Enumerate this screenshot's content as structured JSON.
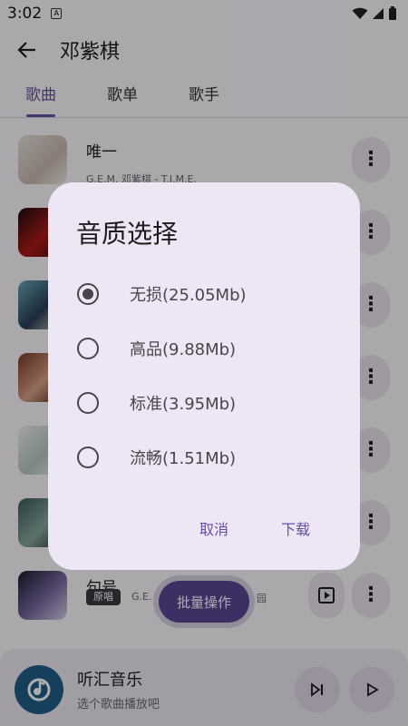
{
  "status": {
    "time": "3:02",
    "notif_glyph": "A"
  },
  "appbar": {
    "title": "邓紫棋"
  },
  "tabs": [
    {
      "label": "歌曲"
    },
    {
      "label": "歌单"
    },
    {
      "label": "歌手"
    }
  ],
  "songs": [
    {
      "title": "唯一",
      "subtitle": "G.E.M. 邓紫棋 - T.I.M.E."
    },
    {
      "title": "",
      "subtitle": ""
    },
    {
      "title": "",
      "subtitle": ""
    },
    {
      "title": "",
      "subtitle": ""
    },
    {
      "title": "",
      "subtitle": ""
    },
    {
      "title": "",
      "subtitle": ""
    },
    {
      "title": "句号",
      "badge": "原唱",
      "subtitle": "G.E.",
      "subtitle_tail": "园"
    }
  ],
  "fab": {
    "label": "批量操作"
  },
  "player": {
    "title": "听汇音乐",
    "subtitle": "选个歌曲播放吧"
  },
  "dialog": {
    "title": "音质选择",
    "options": [
      {
        "label": "无损(25.05Mb)",
        "selected": true
      },
      {
        "label": "高品(9.88Mb)",
        "selected": false
      },
      {
        "label": "标准(3.95Mb)",
        "selected": false
      },
      {
        "label": "流畅(1.51Mb)",
        "selected": false
      }
    ],
    "cancel": "取消",
    "confirm": "下载"
  },
  "colors": {
    "accent": "#6750a4",
    "fab": "#5a4694",
    "dialog_bg": "#ede6f4",
    "player_logo": "#1f5e86"
  }
}
